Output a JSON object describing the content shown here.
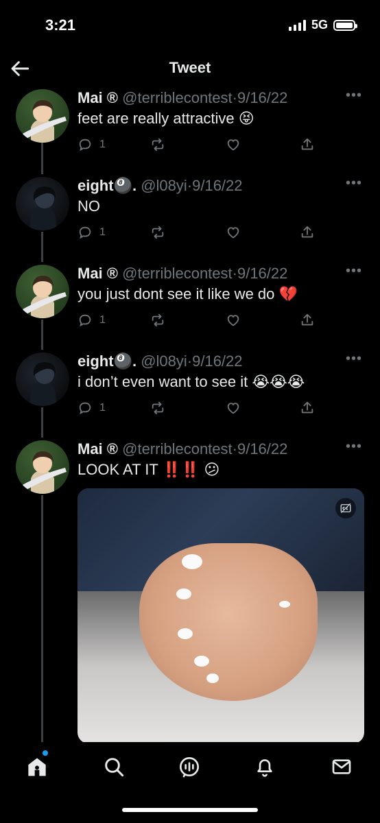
{
  "status_bar": {
    "time": "3:21",
    "network": "5G"
  },
  "header": {
    "title": "Tweet"
  },
  "tweets": [
    {
      "name": "Mai ®",
      "handle": "@terriblecontest",
      "sep": "·",
      "date": "9/16/22",
      "text": "feet are really attractive 😝",
      "reply_count": "1",
      "avatar": "mai"
    },
    {
      "name": "eight🎱.",
      "handle": "@l08yi",
      "sep": "·",
      "date": "9/16/22",
      "text": "NO",
      "reply_count": "1",
      "avatar": "eight"
    },
    {
      "name": "Mai ®",
      "handle": "@terriblecontest",
      "sep": "·",
      "date": "9/16/22",
      "text": "you just dont see it like we do 💔",
      "reply_count": "1",
      "avatar": "mai"
    },
    {
      "name": "eight🎱.",
      "handle": "@l08yi",
      "sep": "·",
      "date": "9/16/22",
      "text": "i don’t even want to see it 😭😭😭",
      "reply_count": "1",
      "avatar": "eight"
    },
    {
      "name": "Mai ®",
      "handle": "@terriblecontest",
      "sep": "·",
      "date": "9/16/22",
      "text": "LOOK AT IT ‼️‼️ 😕",
      "avatar": "mai"
    }
  ],
  "more_label": "•••",
  "icons": {
    "back": "arrow-left-icon",
    "reply": "reply-icon",
    "retweet": "retweet-icon",
    "like": "heart-icon",
    "share": "share-icon",
    "home": "home-icon",
    "search": "search-icon",
    "spaces": "spaces-icon",
    "notifications": "bell-icon",
    "messages": "envelope-icon",
    "cc": "cc-icon"
  },
  "colors": {
    "background": "#000000",
    "text": "#e7e9ea",
    "secondary": "#71767b",
    "accent": "#1d9bf0"
  }
}
